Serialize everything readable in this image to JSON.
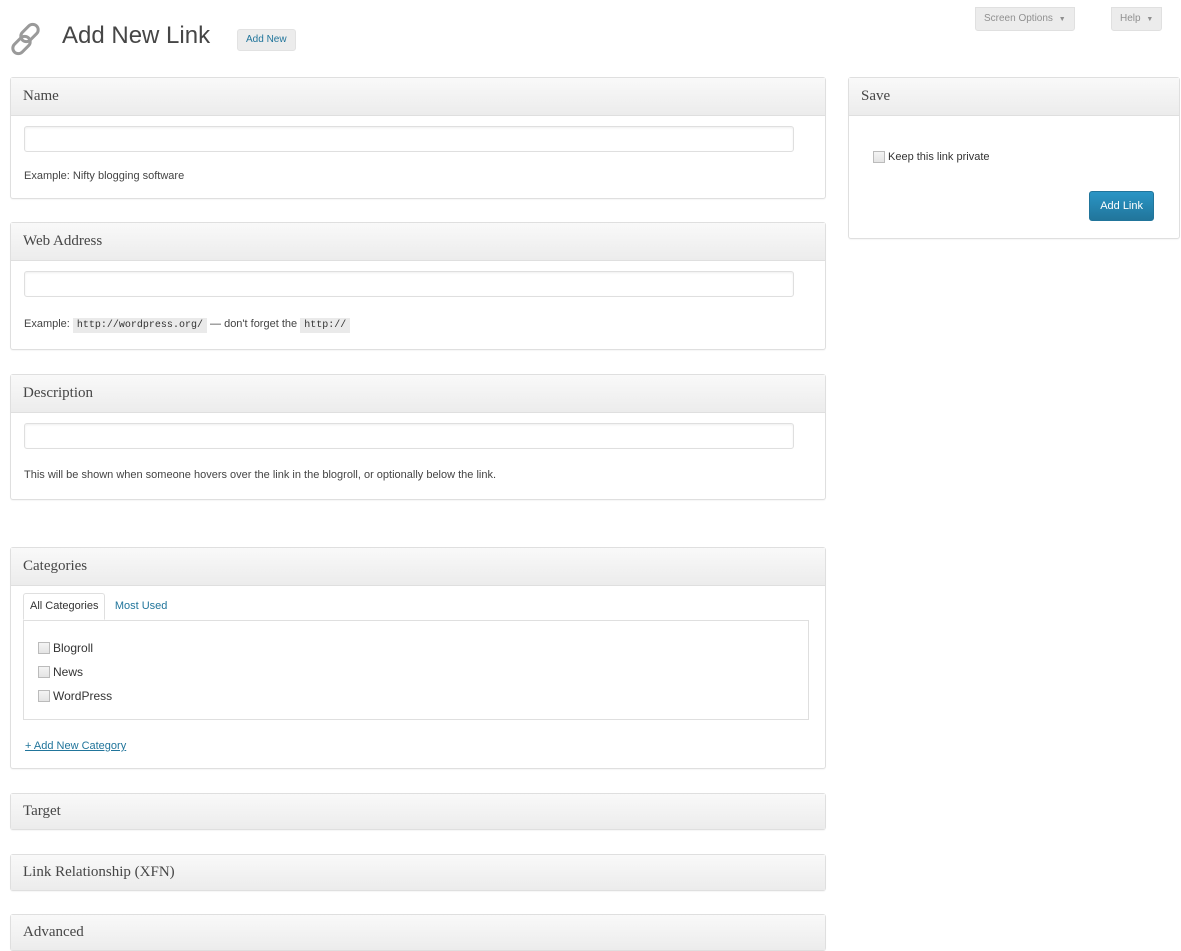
{
  "header": {
    "title": "Add New Link",
    "add_new_label": "Add New",
    "screen_options_label": "Screen Options",
    "help_label": "Help",
    "dropdown_arrow": "▼"
  },
  "name_box": {
    "title": "Name",
    "value": "",
    "hint": "Example: Nifty blogging software"
  },
  "web_address_box": {
    "title": "Web Address",
    "value": "",
    "hint_prefix": "Example:",
    "hint_code1": "http://wordpress.org/",
    "hint_middle": "— don't forget the",
    "hint_code2": "http://"
  },
  "description_box": {
    "title": "Description",
    "value": "",
    "hint": "This will be shown when someone hovers over the link in the blogroll, or optionally below the link."
  },
  "categories_box": {
    "title": "Categories",
    "tabs": [
      "All Categories",
      "Most Used"
    ],
    "items": [
      "Blogroll",
      "News",
      "WordPress"
    ],
    "add_new_category": "+ Add New Category"
  },
  "collapsed_boxes": [
    "Target",
    "Link Relationship (XFN)",
    "Advanced"
  ],
  "save_box": {
    "title": "Save",
    "private_label": "Keep this link private",
    "submit_label": "Add Link"
  },
  "colors": {
    "link": "#21759b",
    "primary_button": "#21759b",
    "border": "#dfdfdf"
  },
  "icons": {
    "page_icon": "link-icon"
  }
}
